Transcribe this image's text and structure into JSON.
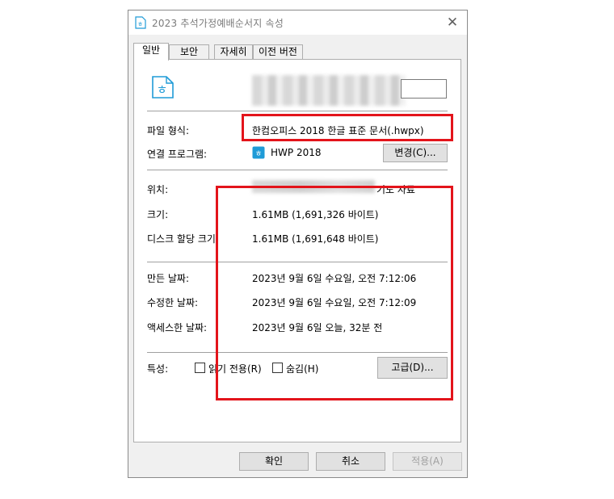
{
  "window": {
    "title": "2023 추석가정예배순서지 속성",
    "close_glyph": "✕"
  },
  "tabs": [
    {
      "label": "일반",
      "active": true
    },
    {
      "label": "보안",
      "active": false
    },
    {
      "label": "자세히",
      "active": false
    },
    {
      "label": "이전 버전",
      "active": false
    }
  ],
  "general": {
    "file_type_label": "파일 형식:",
    "file_type_value": "한컴오피스 2018 한글 표준 문서(.hwpx)",
    "opens_with_label": "연결 프로그램:",
    "opens_with_value": "HWP 2018",
    "change_button": "변경(C)...",
    "location_label": "위치:",
    "location_value_tail": "기도 자료",
    "size_label": "크기:",
    "size_value": "1.61MB (1,691,326 바이트)",
    "disk_size_label": "디스크 할당 크기:",
    "disk_size_value": "1.61MB (1,691,648 바이트)",
    "created_label": "만든 날짜:",
    "created_value": "2023년 9월 6일 수요일, 오전 7:12:06",
    "modified_label": "수정한 날짜:",
    "modified_value": "2023년 9월 6일 수요일, 오전 7:12:09",
    "accessed_label": "액세스한 날짜:",
    "accessed_value": "2023년 9월 6일 오늘, 32분 전",
    "attributes_label": "특성:",
    "readonly_label": "읽기 전용(R)",
    "readonly_checked": false,
    "hidden_label": "숨김(H)",
    "hidden_checked": false,
    "advanced_button": "고급(D)..."
  },
  "footer": {
    "ok": "확인",
    "cancel": "취소",
    "apply": "적용(A)"
  },
  "icons": {
    "title": "hwp-file-icon",
    "large": "hwp-file-icon",
    "program": "hwp-app-icon"
  },
  "colors": {
    "hwp_blue": "#1f9bd7",
    "highlight_red": "#e3141b"
  }
}
